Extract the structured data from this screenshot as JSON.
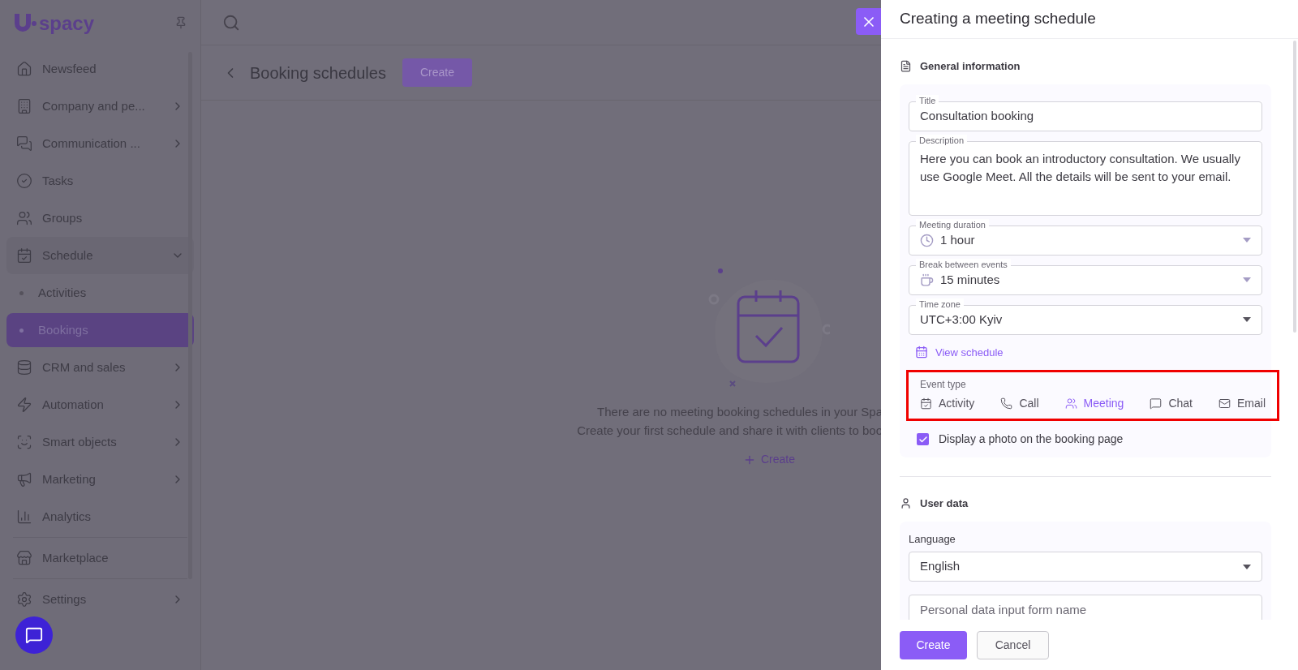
{
  "sidebar": {
    "logo": "spacy",
    "items": [
      {
        "label": "Newsfeed",
        "submenu": false
      },
      {
        "label": "Company and pe...",
        "submenu": true
      },
      {
        "label": "Communication ...",
        "submenu": true
      },
      {
        "label": "Tasks",
        "submenu": false
      },
      {
        "label": "Groups",
        "submenu": false
      },
      {
        "label": "Schedule",
        "submenu": true,
        "expanded": true,
        "children": [
          {
            "label": "Activities",
            "selected": false
          },
          {
            "label": "Bookings",
            "selected": true
          }
        ]
      },
      {
        "label": "CRM and sales",
        "submenu": true
      },
      {
        "label": "Automation",
        "submenu": true
      },
      {
        "label": "Smart objects",
        "submenu": true
      },
      {
        "label": "Marketing",
        "submenu": true
      },
      {
        "label": "Analytics",
        "submenu": false
      },
      {
        "label": "Marketplace",
        "submenu": false
      },
      {
        "label": "Settings",
        "submenu": true
      }
    ]
  },
  "page": {
    "title": "Booking schedules",
    "create_button": "Create",
    "empty_state": {
      "lines": [
        "There are no meeting booking schedules in your Spa",
        "Create your first schedule and share it with clients to boo"
      ],
      "link": "Create"
    }
  },
  "panel": {
    "title": "Creating a meeting schedule",
    "general": {
      "heading": "General information",
      "title_field": {
        "label": "Title",
        "value": "Consultation booking"
      },
      "description": {
        "label": "Description",
        "value": "Here you can book an introductory consultation. We usually use Google Meet. All the details will be sent to your email."
      },
      "selects": [
        {
          "label": "Meeting duration",
          "value": "1 hour"
        },
        {
          "label": "Break between events",
          "value": "15 minutes"
        },
        {
          "label": "Time zone",
          "value": "UTC+3:00 Kyiv"
        }
      ],
      "view_schedule": "View schedule",
      "event_type": {
        "label": "Event type",
        "options": [
          {
            "label": "Activity",
            "selected": false
          },
          {
            "label": "Call",
            "selected": false
          },
          {
            "label": "Meeting",
            "selected": true
          },
          {
            "label": "Chat",
            "selected": false
          },
          {
            "label": "Email",
            "selected": false
          }
        ]
      },
      "photo_checkbox": {
        "label": "Display a photo on the booking page",
        "checked": true
      }
    },
    "user_data": {
      "heading": "User data",
      "language_label": "Language",
      "language": "English",
      "form_name": {
        "placeholder": "Personal data input form name"
      }
    },
    "buttons": {
      "primary": "Create",
      "secondary": "Cancel"
    }
  }
}
